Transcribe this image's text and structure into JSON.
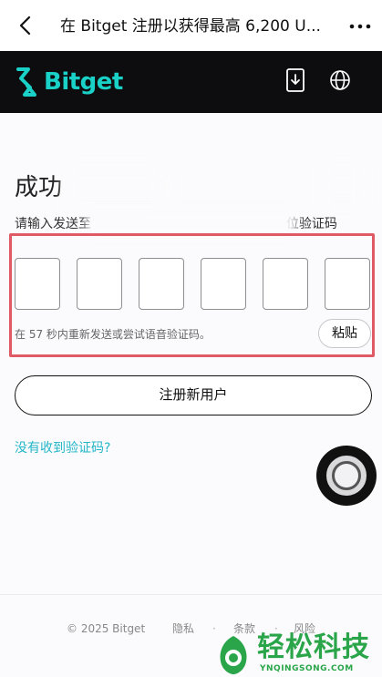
{
  "top_bar": {
    "title": "在 Bitget 注册以获得最高 6,200 U..."
  },
  "brand": {
    "name": "Bitget",
    "color": "#1ad1c8"
  },
  "verify": {
    "title": "成功",
    "instruction_start": "请输入发送至",
    "instruction_end": "位验证码",
    "code_length": 6,
    "resend_text": "在 57 秒内重新发送或尝试语音验证码。",
    "paste_label": "粘贴",
    "register_label": "注册新用户",
    "no_code_link": "没有收到验证码?"
  },
  "footer": {
    "copyright": "© 2025 Bitget",
    "privacy": "隐私",
    "terms": "条款",
    "risk": "风险",
    "separator": "·"
  },
  "watermark": {
    "text": "轻松科技",
    "sub": "YNQINGSONG.COM",
    "color": "#2aa54a"
  },
  "colors": {
    "highlight": "#e05a66",
    "link": "#23b6c8"
  }
}
